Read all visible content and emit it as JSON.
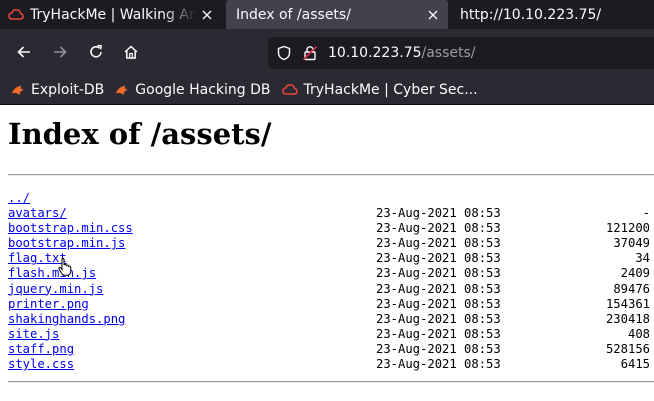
{
  "tabs": [
    {
      "title": "TryHackMe | Walking An A",
      "favicon": "tryhackme-icon",
      "close": "×"
    },
    {
      "title": "Index of /assets/",
      "close": "×"
    },
    {
      "title": "http://10.10.223.75/"
    }
  ],
  "nav": {
    "back": "back-arrow-icon",
    "forward": "forward-arrow-icon",
    "reload": "reload-icon",
    "home": "home-icon",
    "url_host": "10.10.223.75",
    "url_path": "/assets/"
  },
  "bookmarks": [
    {
      "label": "Exploit-DB",
      "icon": "exploit-db-icon"
    },
    {
      "label": "Google Hacking DB",
      "icon": "ghdb-icon"
    },
    {
      "label": "TryHackMe | Cyber Sec...",
      "icon": "tryhackme-icon"
    }
  ],
  "page": {
    "heading": "Index of /assets/",
    "entries": [
      {
        "name": "../",
        "date": "",
        "size": ""
      },
      {
        "name": "avatars/",
        "date": "23-Aug-2021 08:53",
        "size": "-"
      },
      {
        "name": "bootstrap.min.css",
        "date": "23-Aug-2021 08:53",
        "size": "121200"
      },
      {
        "name": "bootstrap.min.js",
        "date": "23-Aug-2021 08:53",
        "size": "37049"
      },
      {
        "name": "flag.txt",
        "date": "23-Aug-2021 08:53",
        "size": "34"
      },
      {
        "name": "flash.min.js",
        "date": "23-Aug-2021 08:53",
        "size": "2409"
      },
      {
        "name": "jquery.min.js",
        "date": "23-Aug-2021 08:53",
        "size": "89476"
      },
      {
        "name": "printer.png",
        "date": "23-Aug-2021 08:53",
        "size": "154361"
      },
      {
        "name": "shakinghands.png",
        "date": "23-Aug-2021 08:53",
        "size": "230418"
      },
      {
        "name": "site.js",
        "date": "23-Aug-2021 08:53",
        "size": "408"
      },
      {
        "name": "staff.png",
        "date": "23-Aug-2021 08:53",
        "size": "528156"
      },
      {
        "name": "style.css",
        "date": "23-Aug-2021 08:53",
        "size": "6415"
      }
    ]
  },
  "colors": {
    "chrome_dark": "#1c1b22",
    "chrome": "#2b2a33",
    "active_tab": "#42414d",
    "link": "#0000ee",
    "thm_red": "#d9534f"
  }
}
